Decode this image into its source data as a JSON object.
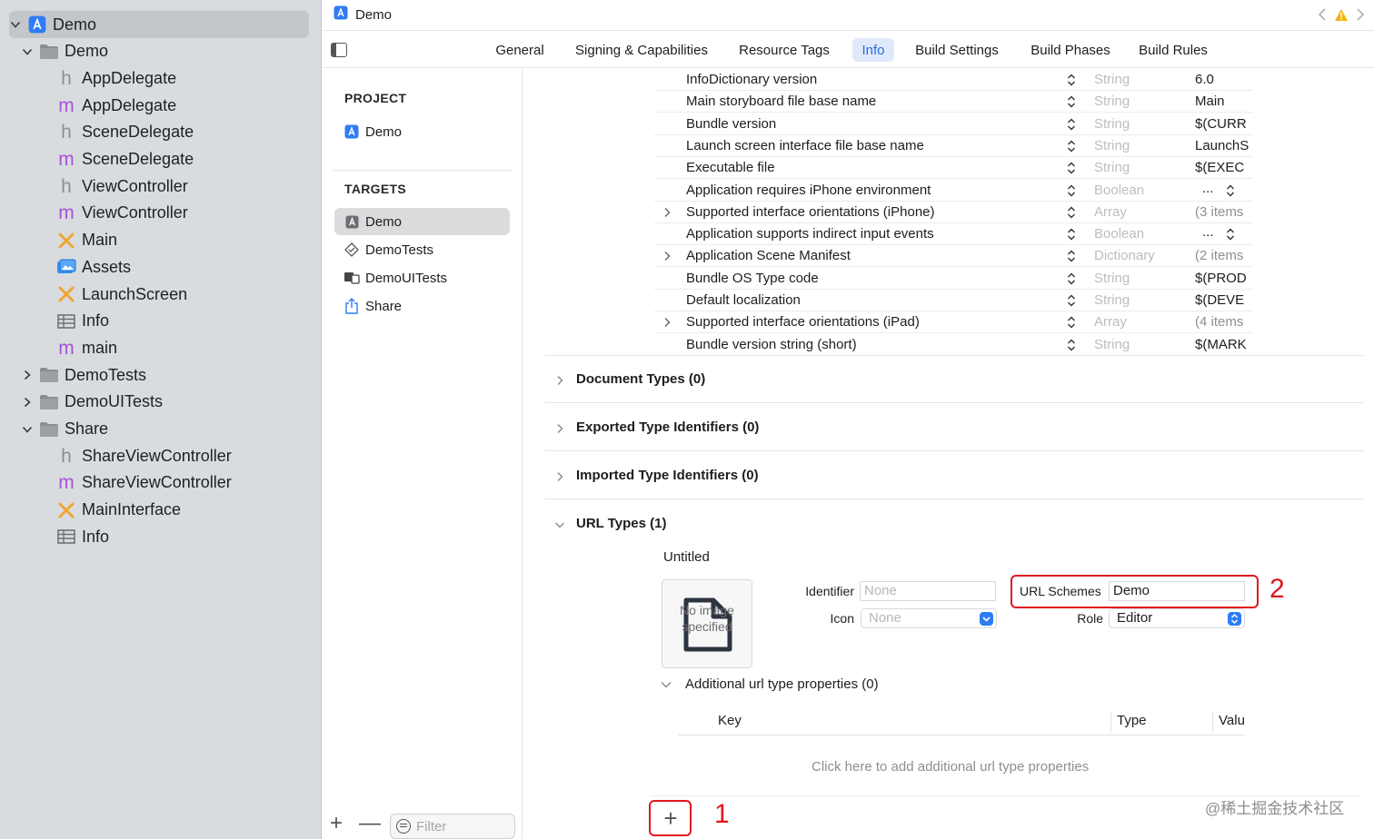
{
  "navigator": {
    "items": [
      {
        "label": "Demo",
        "kind": "project",
        "indent": 0,
        "disclosure": "open",
        "selected": true
      },
      {
        "label": "Demo",
        "kind": "folder",
        "indent": 1,
        "disclosure": "open"
      },
      {
        "label": "AppDelegate",
        "kind": "h",
        "indent": 2
      },
      {
        "label": "AppDelegate",
        "kind": "m",
        "indent": 2
      },
      {
        "label": "SceneDelegate",
        "kind": "h",
        "indent": 2
      },
      {
        "label": "SceneDelegate",
        "kind": "m",
        "indent": 2
      },
      {
        "label": "ViewController",
        "kind": "h",
        "indent": 2
      },
      {
        "label": "ViewController",
        "kind": "m",
        "indent": 2
      },
      {
        "label": "Main",
        "kind": "storyboard",
        "indent": 2
      },
      {
        "label": "Assets",
        "kind": "assets",
        "indent": 2
      },
      {
        "label": "LaunchScreen",
        "kind": "storyboard",
        "indent": 2
      },
      {
        "label": "Info",
        "kind": "plist",
        "indent": 2
      },
      {
        "label": "main",
        "kind": "m",
        "indent": 2
      },
      {
        "label": "DemoTests",
        "kind": "folder",
        "indent": 1,
        "disclosure": "closed"
      },
      {
        "label": "DemoUITests",
        "kind": "folder",
        "indent": 1,
        "disclosure": "closed"
      },
      {
        "label": "Share",
        "kind": "folder",
        "indent": 1,
        "disclosure": "open"
      },
      {
        "label": "ShareViewController",
        "kind": "h",
        "indent": 2
      },
      {
        "label": "ShareViewController",
        "kind": "m",
        "indent": 2
      },
      {
        "label": "MainInterface",
        "kind": "storyboard",
        "indent": 2
      },
      {
        "label": "Info",
        "kind": "plist",
        "indent": 2
      }
    ]
  },
  "topbar": {
    "title": "Demo"
  },
  "tabs": [
    {
      "label": "General",
      "active": false
    },
    {
      "label": "Signing & Capabilities",
      "active": false
    },
    {
      "label": "Resource Tags",
      "active": false
    },
    {
      "label": "Info",
      "active": true
    },
    {
      "label": "Build Settings",
      "active": false
    },
    {
      "label": "Build Phases",
      "active": false
    },
    {
      "label": "Build Rules",
      "active": false
    }
  ],
  "targets_panel": {
    "project_header": "PROJECT",
    "project_name": "Demo",
    "targets_header": "TARGETS",
    "targets": [
      {
        "label": "Demo",
        "icon": "app-target-icon",
        "selected": true
      },
      {
        "label": "DemoTests",
        "icon": "test-target-icon",
        "selected": false
      },
      {
        "label": "DemoUITests",
        "icon": "ui-test-target-icon",
        "selected": false
      },
      {
        "label": "Share",
        "icon": "share-extension-icon",
        "selected": false
      }
    ],
    "filter_placeholder": "Filter",
    "add_label": "+",
    "remove_label": "—"
  },
  "plist_rows": [
    {
      "key": "InfoDictionary version",
      "type": "String",
      "value": "6.0"
    },
    {
      "key": "Main storyboard file base name",
      "type": "String",
      "value": "Main"
    },
    {
      "key": "Bundle version",
      "type": "String",
      "value": "$(CURR"
    },
    {
      "key": "Launch screen interface file base name",
      "type": "String",
      "value": "LaunchS"
    },
    {
      "key": "Executable file",
      "type": "String",
      "value": "$(EXEC"
    },
    {
      "key": "Application requires iPhone environment",
      "type": "Boolean",
      "value": "...",
      "popup": true
    },
    {
      "key": "Supported interface orientations (iPhone)",
      "type": "Array",
      "value": "(3 items",
      "expandable": true,
      "gray": true
    },
    {
      "key": "Application supports indirect input events",
      "type": "Boolean",
      "value": "...",
      "popup": true
    },
    {
      "key": "Application Scene Manifest",
      "type": "Dictionary",
      "value": "(2 items",
      "expandable": true,
      "gray": true
    },
    {
      "key": "Bundle OS Type code",
      "type": "String",
      "value": "$(PROD"
    },
    {
      "key": "Default localization",
      "type": "String",
      "value": "$(DEVE"
    },
    {
      "key": "Supported interface orientations (iPad)",
      "type": "Array",
      "value": "(4 items",
      "expandable": true,
      "gray": true
    },
    {
      "key": "Bundle version string (short)",
      "type": "String",
      "value": "$(MARK"
    }
  ],
  "sections": [
    {
      "label": "Document Types (0)",
      "expanded": false
    },
    {
      "label": "Exported Type Identifiers (0)",
      "expanded": false
    },
    {
      "label": "Imported Type Identifiers (0)",
      "expanded": false
    },
    {
      "label": "URL Types (1)",
      "expanded": true
    }
  ],
  "url_type": {
    "name": "Untitled",
    "image_placeholder": "No image specified",
    "identifier_label": "Identifier",
    "identifier_placeholder": "None",
    "icon_label": "Icon",
    "icon_placeholder": "None",
    "url_schemes_label": "URL Schemes",
    "url_schemes_value": "Demo",
    "role_label": "Role",
    "role_value": "Editor",
    "additional_label": "Additional url type properties (0)",
    "table_headers": {
      "key": "Key",
      "type": "Type",
      "value": "Valu"
    },
    "empty_hint": "Click here to add additional url type properties",
    "add_label": "+"
  },
  "annotations": {
    "one": "1",
    "two": "2"
  },
  "watermark": "@稀土掘金技术社区",
  "colors": {
    "accent": "#2d6be0",
    "annotation_red": "#e0161e",
    "sidebar_bg": "#d9dcdf"
  }
}
